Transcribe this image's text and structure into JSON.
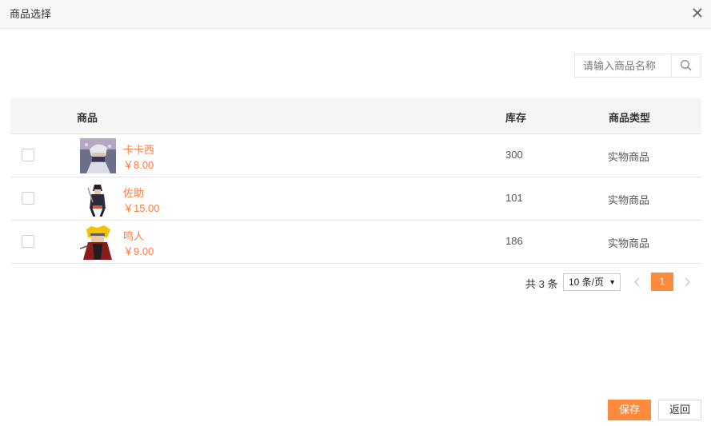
{
  "dialog": {
    "title": "商品选择"
  },
  "search": {
    "placeholder": "请输入商品名称"
  },
  "table": {
    "headers": {
      "goods": "商品",
      "stock": "库存",
      "type": "商品类型"
    },
    "rows": [
      {
        "name": "卡卡西",
        "price": "￥8.00",
        "stock": "300",
        "type": "实物商品"
      },
      {
        "name": "佐助",
        "price": "￥15.00",
        "stock": "101",
        "type": "实物商品"
      },
      {
        "name": "鸣人",
        "price": "￥9.00",
        "stock": "186",
        "type": "实物商品"
      }
    ]
  },
  "pagination": {
    "total_text": "共 3 条",
    "page_size": "10 条/页",
    "current_page": "1"
  },
  "buttons": {
    "save": "保存",
    "back": "返回"
  },
  "colors": {
    "accent": "#ff8a3d",
    "link": "#ff7a3d"
  }
}
